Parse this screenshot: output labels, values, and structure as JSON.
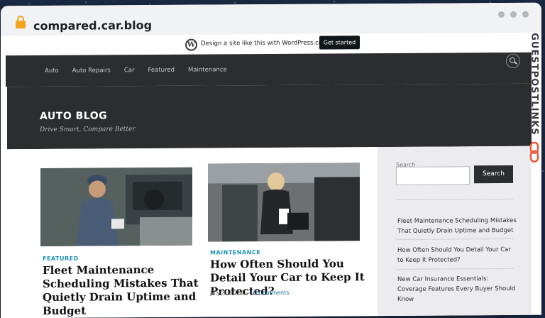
{
  "browser": {
    "url": "compared.car.blog"
  },
  "wordpress_bar": {
    "logo": "W",
    "text": "Design a site like this with WordPress.com",
    "button": "Get started"
  },
  "nav": {
    "items": [
      "Auto",
      "Auto Repairs",
      "Car",
      "Featured",
      "Maintenance"
    ]
  },
  "site": {
    "title": "AUTO BLOG",
    "tagline": "Drive Smart, Compare Better"
  },
  "posts": [
    {
      "category": "FEATURED",
      "title": "Fleet Maintenance Scheduling Mistakes That Quietly Drain Uptime and Budget"
    },
    {
      "category": "MAINTENANCE",
      "title": "How Often Should You Detail Your Car to Keep It Protected?",
      "date": "July 8, 2026",
      "separator": "—",
      "comments": "0 Comments"
    }
  ],
  "sidebar": {
    "search_label": "Search",
    "search_button": "Search",
    "recent": [
      "Fleet Maintenance Scheduling Mistakes That Quietly Drain Uptime and Budget",
      "How Often Should You Detail Your Car to Keep It Protected?",
      "New Car Insurance Essentials: Coverage Features Every Buyer Should Know"
    ]
  },
  "badge": {
    "text": "GUESTPOSTLINKS"
  }
}
